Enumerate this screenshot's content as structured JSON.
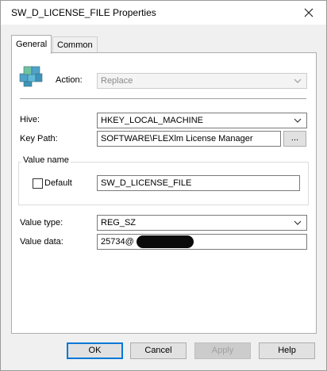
{
  "window": {
    "title": "SW_D_LICENSE_FILE Properties"
  },
  "tabs": [
    {
      "label": "General",
      "active": true
    },
    {
      "label": "Common",
      "active": false
    }
  ],
  "general": {
    "action_label": "Action:",
    "action_value": "Replace",
    "hive_label": "Hive:",
    "hive_value": "HKEY_LOCAL_MACHINE",
    "key_path_label": "Key Path:",
    "key_path_value": "SOFTWARE\\FLEXlm License Manager",
    "browse_label": "...",
    "value_name_group": "Value name",
    "default_label": "Default",
    "default_checked": false,
    "value_name_value": "SW_D_LICENSE_FILE",
    "value_type_label": "Value type:",
    "value_type_value": "REG_SZ",
    "value_data_label": "Value data:",
    "value_data_value": "25734@"
  },
  "buttons": {
    "ok": "OK",
    "cancel": "Cancel",
    "apply": "Apply",
    "help": "Help"
  },
  "icons": {
    "close": "close-icon",
    "registry": "registry-cubes-icon",
    "dropdown": "chevron-down-icon"
  },
  "colors": {
    "accent": "#0078d7",
    "panel": "#ffffff",
    "chrome": "#f0f0f0"
  }
}
